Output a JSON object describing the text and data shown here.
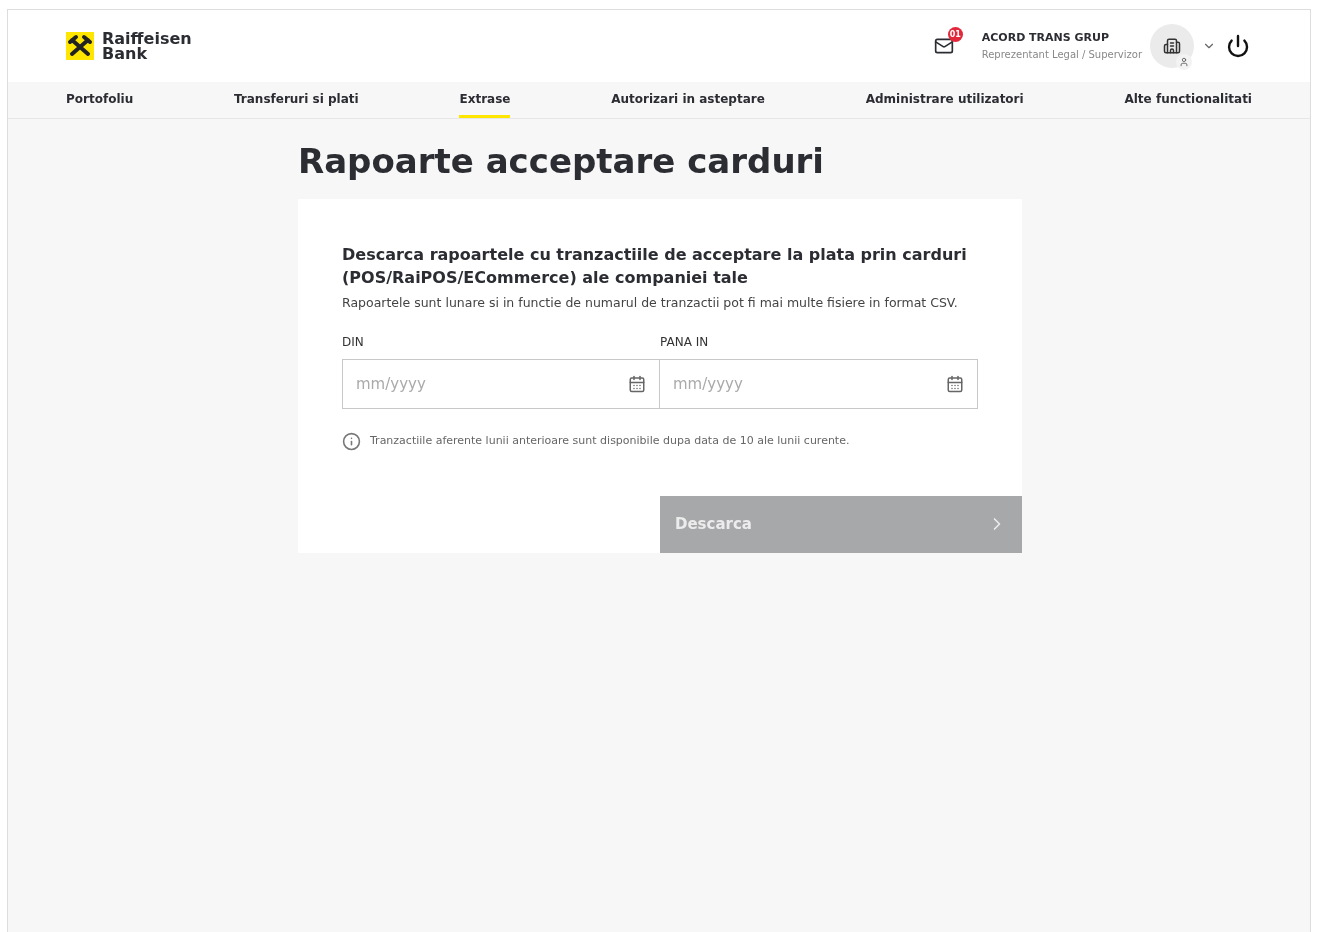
{
  "logo": {
    "line1": "Raiffeisen",
    "line2": "Bank"
  },
  "header": {
    "messages_badge": "01",
    "company": "ACORD TRANS GRUP",
    "role": "Reprezentant Legal / Supervizor"
  },
  "nav": [
    {
      "label": "Portofoliu",
      "selected": false
    },
    {
      "label": "Transferuri si plati",
      "selected": false
    },
    {
      "label": "Extrase",
      "selected": true
    },
    {
      "label": "Autorizari in asteptare",
      "selected": false
    },
    {
      "label": "Administrare utilizatori",
      "selected": false
    },
    {
      "label": "Alte functionalitati",
      "selected": false
    }
  ],
  "page_title": "Rapoarte acceptare carduri",
  "card": {
    "heading": "Descarca rapoartele cu tranzactiile de acceptare la plata prin carduri (POS/RaiPOS/ECommerce) ale companiei tale",
    "description": "Rapoartele sunt lunare si in functie de numarul de tranzactii pot fi mai multe fisiere in format CSV.",
    "fields": [
      {
        "label": "DIN",
        "placeholder": "mm/yyyy"
      },
      {
        "label": "PANA IN",
        "placeholder": "mm/yyyy"
      }
    ],
    "info": "Tranzactiile aferente lunii anterioare sunt disponibile dupa data de 10 ale lunii curente.",
    "button": {
      "label": "Descarca",
      "disabled": true
    }
  }
}
